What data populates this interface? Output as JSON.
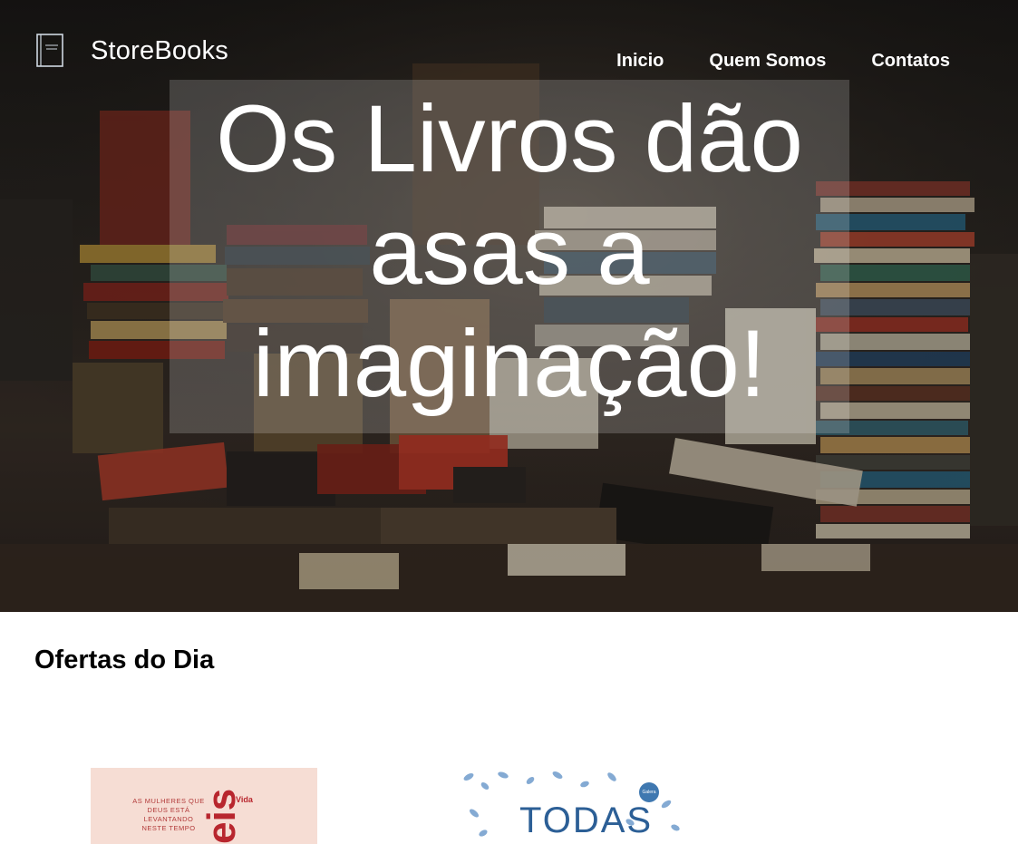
{
  "header": {
    "brand_name": "StoreBooks",
    "brand_icon": "book-icon",
    "nav": [
      "Inicio",
      "Quem Somos",
      "Contatos"
    ]
  },
  "hero": {
    "headline_lines": [
      "Os Livros dão",
      "asas a",
      "imaginação!"
    ]
  },
  "offers": {
    "title": "Ofertas do Dia",
    "books": [
      {
        "cover_small_text": "AS MULHERES QUE DEUS ESTÁ LEVANTANDO NESTE TEMPO",
        "cover_big_text": "eis",
        "publisher": "Vida"
      },
      {
        "cover_big_text": "TODAS",
        "publisher": "Galera"
      }
    ]
  },
  "colors": {
    "nav_text": "#ffffff",
    "hero_overlay": "#ffffff2e",
    "book1_bg": "#f6ddd4",
    "book1_accent": "#b8262e",
    "book2_accent": "#2c5f96"
  }
}
